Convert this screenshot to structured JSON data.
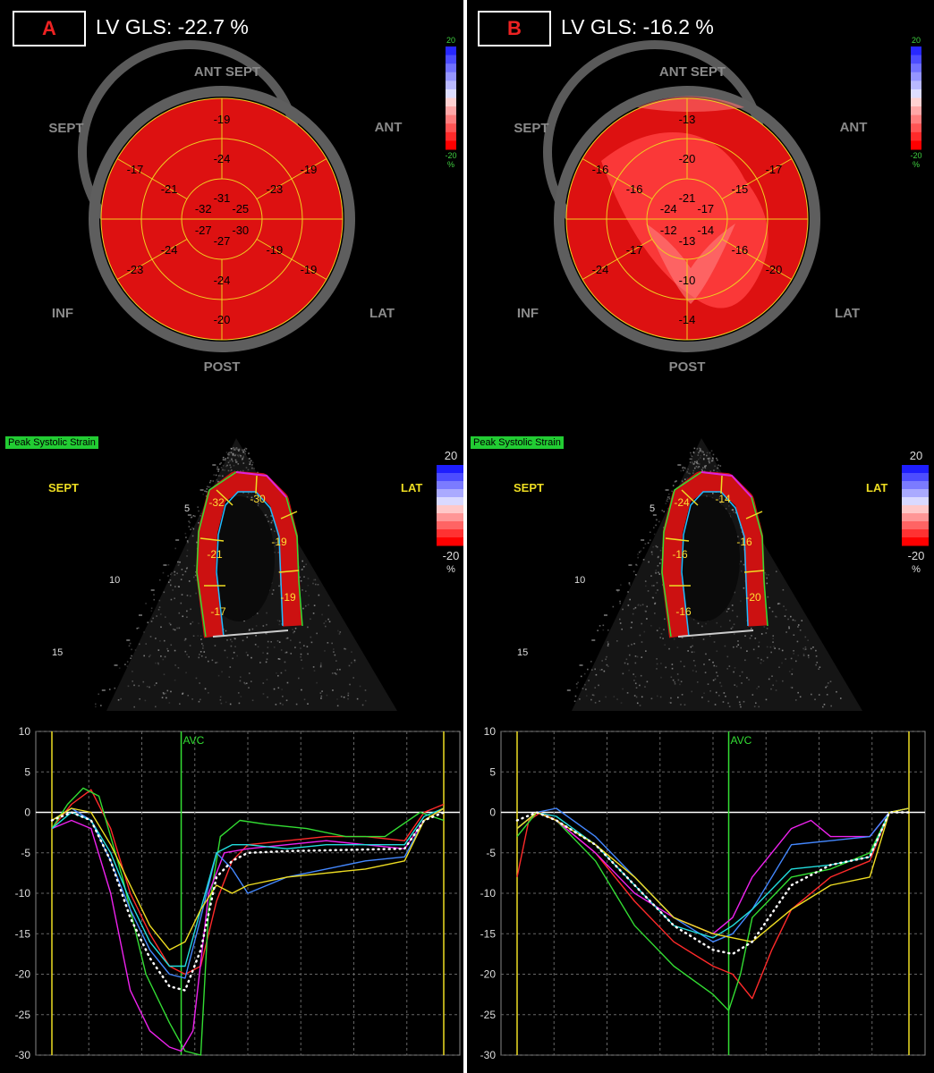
{
  "panels": [
    {
      "id": "A",
      "letter": "A",
      "gls": "LV GLS: -22.7 %",
      "bullseye": {
        "walls": {
          "ant_sept": "ANT SEPT",
          "ant": "ANT",
          "sept": "SEPT",
          "inf": "INF",
          "lat": "LAT",
          "post": "POST"
        },
        "segments": {
          "basal": [
            "-19",
            "-19",
            "-19",
            "-20",
            "-23",
            "-17"
          ],
          "mid": [
            "-24",
            "-23",
            "-19",
            "-24",
            "-24",
            "-21"
          ],
          "apical": [
            "-31",
            "-25",
            "-30",
            "-27",
            "-27",
            "-32"
          ]
        },
        "scale": {
          "max": "20",
          "min": "-20",
          "unit": "%"
        }
      },
      "echo": {
        "label": "Peak Systolic Strain",
        "sept": "SEPT",
        "lat": "LAT",
        "depths": [
          "5",
          "10",
          "15"
        ],
        "segment_values": [
          "-17",
          "-21",
          "-32",
          "-30",
          "-19",
          "-19"
        ],
        "scale": {
          "max": "20",
          "min": "-20",
          "unit": "%"
        }
      },
      "curves": {
        "avc_label": "AVC",
        "y_ticks": [
          "10",
          "5",
          "0",
          "-5",
          "-10",
          "-15",
          "-20",
          "-25",
          "-30"
        ]
      }
    },
    {
      "id": "B",
      "letter": "B",
      "gls": "LV GLS: -16.2 %",
      "bullseye": {
        "walls": {
          "ant_sept": "ANT SEPT",
          "ant": "ANT",
          "sept": "SEPT",
          "inf": "INF",
          "lat": "LAT",
          "post": "POST"
        },
        "segments": {
          "basal": [
            "-13",
            "-17",
            "-20",
            "-14",
            "-24",
            "-16"
          ],
          "mid": [
            "-20",
            "-15",
            "-16",
            "-10",
            "-17",
            "-16"
          ],
          "apical": [
            "-21",
            "-17",
            "-14",
            "-13",
            "-12",
            "-24"
          ]
        },
        "scale": {
          "max": "20",
          "min": "-20",
          "unit": "%"
        }
      },
      "echo": {
        "label": "Peak Systolic Strain",
        "sept": "SEPT",
        "lat": "LAT",
        "depths": [
          "5",
          "10",
          "15"
        ],
        "segment_values": [
          "-16",
          "-16",
          "-24",
          "-14",
          "-16",
          "-20"
        ],
        "scale": {
          "max": "20",
          "min": "-20",
          "unit": "%"
        }
      },
      "curves": {
        "avc_label": "AVC",
        "y_ticks": [
          "10",
          "5",
          "0",
          "-5",
          "-10",
          "-15",
          "-20",
          "-25",
          "-30"
        ]
      }
    }
  ],
  "chart_data": [
    {
      "type": "line",
      "ylim": [
        -30,
        10
      ],
      "xlim": [
        0,
        1
      ],
      "avc": 0.33,
      "series": [
        {
          "color": "#ff2a2a",
          "x": [
            0,
            0.05,
            0.1,
            0.15,
            0.2,
            0.25,
            0.3,
            0.34,
            0.38,
            0.42,
            0.46,
            0.5,
            0.6,
            0.7,
            0.8,
            0.9,
            0.95,
            1.0
          ],
          "y": [
            -2,
            1,
            2.8,
            -2,
            -10,
            -15,
            -19,
            -20,
            -19,
            -11,
            -6,
            -4,
            -3.5,
            -3,
            -3,
            -3.5,
            0,
            1
          ]
        },
        {
          "color": "#33dd33",
          "x": [
            0,
            0.04,
            0.08,
            0.12,
            0.18,
            0.24,
            0.3,
            0.34,
            0.38,
            0.4,
            0.43,
            0.48,
            0.55,
            0.65,
            0.75,
            0.85,
            0.94,
            1.0
          ],
          "y": [
            -2,
            1,
            3,
            2,
            -8,
            -20,
            -26,
            -29.5,
            -30,
            -12,
            -3,
            -1,
            -1.5,
            -2,
            -3,
            -3,
            0,
            -1
          ]
        },
        {
          "color": "#ee22ee",
          "x": [
            0,
            0.05,
            0.1,
            0.15,
            0.2,
            0.25,
            0.3,
            0.33,
            0.36,
            0.4,
            0.44,
            0.5,
            0.6,
            0.7,
            0.8,
            0.9,
            0.95,
            1.0
          ],
          "y": [
            -2,
            -1,
            -2,
            -10,
            -22,
            -27,
            -29,
            -29.5,
            -27,
            -10,
            -5,
            -4.5,
            -4,
            -3.5,
            -4,
            -4.5,
            -1,
            0.5
          ]
        },
        {
          "color": "#4488ff",
          "x": [
            0,
            0.05,
            0.1,
            0.15,
            0.2,
            0.25,
            0.3,
            0.34,
            0.38,
            0.42,
            0.46,
            0.5,
            0.6,
            0.7,
            0.8,
            0.9,
            0.95,
            1.0
          ],
          "y": [
            -1,
            0.5,
            -1,
            -6,
            -12,
            -17,
            -20,
            -20.5,
            -13,
            -5,
            -7,
            -10,
            -8,
            -7,
            -6,
            -5.5,
            -1,
            0.5
          ]
        },
        {
          "color": "#22dddd",
          "x": [
            0,
            0.05,
            0.1,
            0.15,
            0.2,
            0.25,
            0.3,
            0.34,
            0.38,
            0.42,
            0.46,
            0.5,
            0.6,
            0.7,
            0.8,
            0.9,
            0.95,
            1.0
          ],
          "y": [
            -2,
            0,
            -1,
            -5,
            -11,
            -16,
            -19,
            -19,
            -12,
            -5,
            -4,
            -4,
            -4.5,
            -4,
            -4,
            -4,
            -0.5,
            0.5
          ]
        },
        {
          "color": "#eedd22",
          "x": [
            0,
            0.05,
            0.1,
            0.15,
            0.2,
            0.25,
            0.3,
            0.34,
            0.38,
            0.42,
            0.46,
            0.5,
            0.6,
            0.7,
            0.8,
            0.9,
            0.95,
            1.0
          ],
          "y": [
            -1,
            0.5,
            0,
            -4,
            -9,
            -14,
            -17,
            -16,
            -12,
            -9,
            -10,
            -9,
            -8,
            -7.5,
            -7,
            -6,
            -1,
            0.5
          ]
        },
        {
          "color": "#ffffff",
          "dotted": true,
          "x": [
            0,
            0.05,
            0.1,
            0.15,
            0.2,
            0.25,
            0.3,
            0.34,
            0.38,
            0.42,
            0.46,
            0.5,
            0.6,
            0.7,
            0.8,
            0.9,
            0.95,
            1.0
          ],
          "y": [
            -1,
            0,
            -1,
            -6,
            -13,
            -18,
            -21.5,
            -22,
            -17,
            -8,
            -6,
            -5,
            -4.8,
            -4.7,
            -4.6,
            -4.5,
            -1,
            0
          ]
        }
      ]
    },
    {
      "type": "line",
      "ylim": [
        -30,
        10
      ],
      "xlim": [
        0,
        1
      ],
      "avc": 0.54,
      "series": [
        {
          "color": "#ff2a2a",
          "x": [
            0,
            0.03,
            0.06,
            0.1,
            0.2,
            0.3,
            0.4,
            0.5,
            0.55,
            0.6,
            0.65,
            0.7,
            0.8,
            0.9,
            0.95,
            1.0
          ],
          "y": [
            -8,
            -1,
            0,
            -1,
            -5,
            -11,
            -16,
            -19,
            -20,
            -23,
            -17,
            -12,
            -8,
            -6,
            0,
            0.5
          ]
        },
        {
          "color": "#33dd33",
          "x": [
            0,
            0.05,
            0.1,
            0.2,
            0.3,
            0.4,
            0.5,
            0.54,
            0.57,
            0.6,
            0.7,
            0.8,
            0.9,
            0.95,
            1.0
          ],
          "y": [
            -3,
            0,
            -1,
            -6,
            -14,
            -19,
            -22.5,
            -24.5,
            -20,
            -13,
            -8,
            -7,
            -5,
            0,
            0.5
          ]
        },
        {
          "color": "#ee22ee",
          "x": [
            0,
            0.05,
            0.1,
            0.2,
            0.3,
            0.4,
            0.5,
            0.55,
            0.6,
            0.7,
            0.75,
            0.8,
            0.9,
            0.95,
            1.0
          ],
          "y": [
            -2,
            0,
            -1,
            -5,
            -10,
            -13,
            -15,
            -13,
            -8,
            -2,
            -1,
            -3,
            -3,
            0,
            0.5
          ]
        },
        {
          "color": "#4488ff",
          "x": [
            0,
            0.05,
            0.1,
            0.2,
            0.3,
            0.4,
            0.5,
            0.55,
            0.6,
            0.7,
            0.8,
            0.9,
            0.95,
            1.0
          ],
          "y": [
            -2,
            0,
            0.5,
            -3,
            -8,
            -13,
            -16,
            -15,
            -12,
            -4,
            -3.5,
            -3,
            0,
            0.5
          ]
        },
        {
          "color": "#22dddd",
          "x": [
            0,
            0.05,
            0.1,
            0.2,
            0.3,
            0.4,
            0.5,
            0.55,
            0.6,
            0.7,
            0.8,
            0.9,
            0.95,
            1.0
          ],
          "y": [
            -2,
            0,
            -0.5,
            -4,
            -9,
            -14,
            -15.5,
            -14,
            -12,
            -7,
            -6.5,
            -5.5,
            0,
            0.5
          ]
        },
        {
          "color": "#eedd22",
          "x": [
            0,
            0.05,
            0.1,
            0.2,
            0.3,
            0.4,
            0.5,
            0.55,
            0.6,
            0.7,
            0.8,
            0.9,
            0.95,
            1.0
          ],
          "y": [
            -2,
            0,
            -1,
            -4,
            -8,
            -13,
            -15,
            -15.5,
            -16,
            -12,
            -9,
            -8,
            0,
            0.5
          ]
        },
        {
          "color": "#ffffff",
          "dotted": true,
          "x": [
            0,
            0.05,
            0.1,
            0.2,
            0.3,
            0.4,
            0.5,
            0.55,
            0.6,
            0.7,
            0.8,
            0.9,
            0.95,
            1.0
          ],
          "y": [
            -1,
            0,
            -1,
            -4,
            -9,
            -14,
            -17,
            -17.5,
            -16,
            -9,
            -6.5,
            -5.5,
            0,
            0
          ]
        }
      ]
    }
  ]
}
